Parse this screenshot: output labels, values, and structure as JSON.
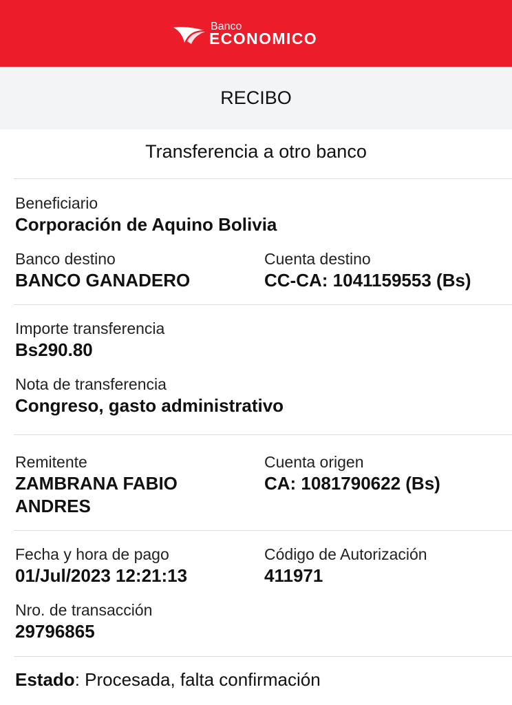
{
  "header": {
    "brand_small": "Banco",
    "brand_big": "ECONOMICO",
    "brand_color": "#ed1c2b"
  },
  "subbar": {
    "title": "RECIBO"
  },
  "section_title": "Transferencia a otro banco",
  "fields": {
    "beneficiario": {
      "label": "Beneficiario",
      "value": "Corporación de Aquino Bolivia"
    },
    "banco_destino": {
      "label": "Banco destino",
      "value": "BANCO GANADERO"
    },
    "cuenta_destino": {
      "label": "Cuenta destino",
      "value": "CC-CA: 1041159553 (Bs)"
    },
    "importe": {
      "label": "Importe transferencia",
      "value": "Bs290.80"
    },
    "nota": {
      "label": "Nota de transferencia",
      "value": "Congreso, gasto administrativo"
    },
    "remitente": {
      "label": "Remitente",
      "value": "ZAMBRANA FABIO ANDRES"
    },
    "cuenta_origen": {
      "label": "Cuenta origen",
      "value": "CA: 1081790622 (Bs)"
    },
    "fecha": {
      "label": "Fecha y hora de pago",
      "value": "01/Jul/2023 12:21:13"
    },
    "codigo": {
      "label": "Código de Autorización",
      "value": "411971"
    },
    "nro": {
      "label": "Nro. de transacción",
      "value": "29796865"
    }
  },
  "status": {
    "label": "Estado",
    "separator": ": ",
    "value": "Procesada, falta confirmación"
  }
}
